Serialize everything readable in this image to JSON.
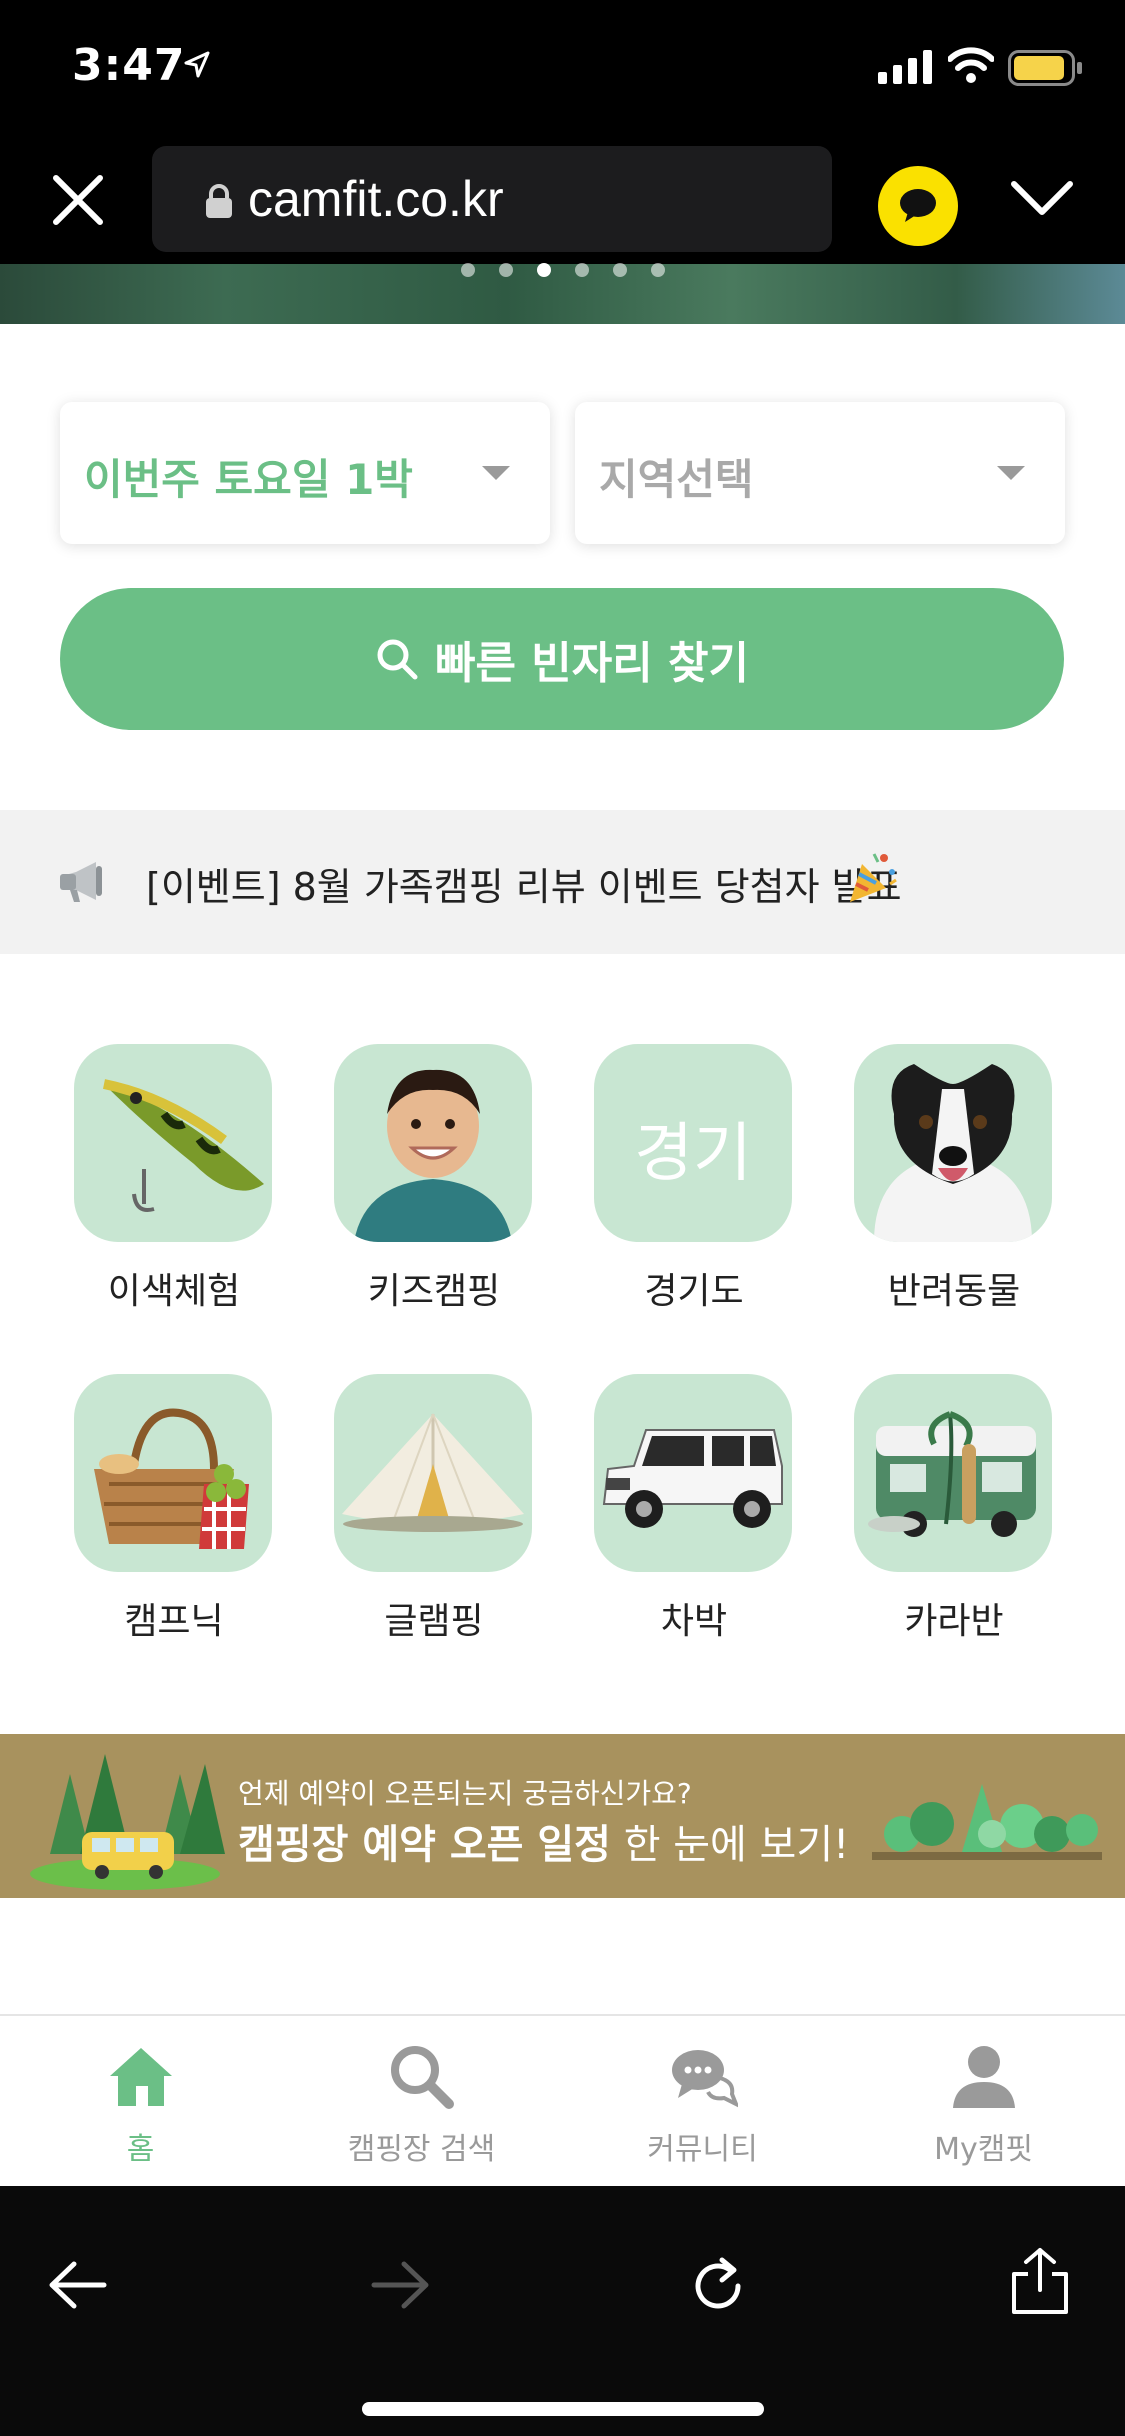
{
  "status_bar": {
    "time": "3:47"
  },
  "browser": {
    "url": "camfit.co.kr"
  },
  "carousel": {
    "dot_count": 6,
    "active_index": 2
  },
  "search": {
    "date_label": "이번주 토요일 1박",
    "region_label": "지역선택",
    "button_label": "빠른 빈자리 찾기"
  },
  "notice": {
    "text": "[이벤트] 8월 가족캠핑 리뷰 이벤트 당첨자 발표"
  },
  "categories": [
    {
      "label": "이색체험",
      "icon": "fishing-lure-icon"
    },
    {
      "label": "키즈캠핑",
      "icon": "child-icon"
    },
    {
      "label": "경기도",
      "icon": "gyeonggi-text-icon",
      "thumb_text": "경기"
    },
    {
      "label": "반려동물",
      "icon": "dog-icon"
    },
    {
      "label": "캠프닉",
      "icon": "picnic-basket-icon"
    },
    {
      "label": "글램핑",
      "icon": "tent-icon"
    },
    {
      "label": "차박",
      "icon": "suv-icon"
    },
    {
      "label": "카라반",
      "icon": "caravan-icon"
    }
  ],
  "banner": {
    "line1": "언제 예약이 오픈되는지 궁금하신가요?",
    "line2_bold": "캠핑장 예약 오픈 일정",
    "line2_rest": " 한 눈에 보기!"
  },
  "tabbar": {
    "items": [
      {
        "label": "홈",
        "icon": "home-icon",
        "active": true
      },
      {
        "label": "캠핑장 검색",
        "icon": "search-icon",
        "active": false
      },
      {
        "label": "커뮤니티",
        "icon": "chat-bubbles-icon",
        "active": false
      },
      {
        "label": "My캠핏",
        "icon": "user-icon",
        "active": false
      }
    ]
  },
  "colors": {
    "accent": "#6bbf86",
    "thumb_bg": "#c8e6d2",
    "banner_bg": "#a8925e",
    "kakao": "#fae100"
  }
}
